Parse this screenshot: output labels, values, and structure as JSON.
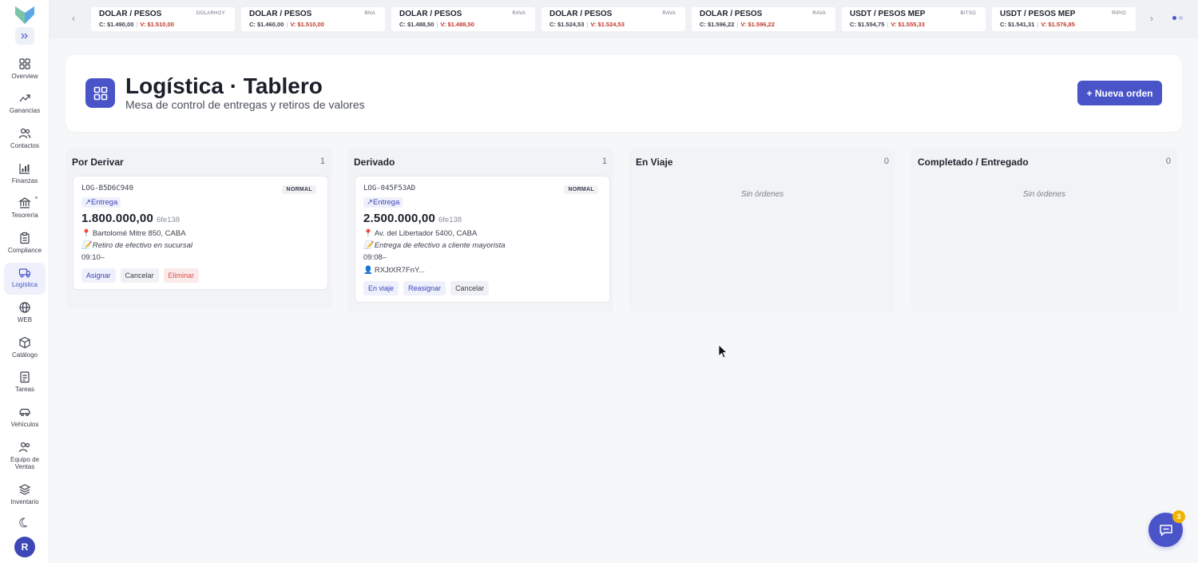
{
  "sidebar": {
    "items": [
      {
        "label": "Overview",
        "icon": "grid-icon"
      },
      {
        "label": "Ganancias",
        "icon": "trend-up-icon"
      },
      {
        "label": "Contactos",
        "icon": "users-icon"
      },
      {
        "label": "Finanzas",
        "icon": "bar-chart-icon"
      },
      {
        "label": "Tesorería",
        "icon": "bank-icon"
      },
      {
        "label": "Compliance",
        "icon": "clipboard-icon"
      },
      {
        "label": "Logística",
        "icon": "truck-icon"
      },
      {
        "label": "WEB",
        "icon": "globe-icon"
      },
      {
        "label": "Catálogo",
        "icon": "box-icon"
      },
      {
        "label": "Tareas",
        "icon": "checklist-icon"
      },
      {
        "label": "Vehículos",
        "icon": "car-icon"
      },
      {
        "label": "Equipo de Ventas",
        "icon": "team-icon"
      },
      {
        "label": "Inventario",
        "icon": "layers-icon"
      }
    ],
    "active": "Logística",
    "avatar": "R"
  },
  "ticker": {
    "items": [
      {
        "pair": "DOLAR / PESOS",
        "source": "DOLARHOY",
        "buy": "C: $1.490,00",
        "sell": "V: $1.510,00"
      },
      {
        "pair": "DOLAR / PESOS",
        "source": "BNA",
        "buy": "C: $1.460,00",
        "sell": "V: $1.510,00"
      },
      {
        "pair": "DOLAR / PESOS",
        "source": "RAVA",
        "buy": "C: $1.488,50",
        "sell": "V: $1.488,50"
      },
      {
        "pair": "DOLAR / PESOS",
        "source": "RAVA",
        "buy": "C: $1.524,53",
        "sell": "V: $1.524,53"
      },
      {
        "pair": "DOLAR / PESOS",
        "source": "RAVA",
        "buy": "C: $1.596,22",
        "sell": "V: $1.596,22"
      },
      {
        "pair": "USDT / PESOS MEP",
        "source": "BITSO",
        "buy": "C: $1.554,75",
        "sell": "V: $1.555,33"
      },
      {
        "pair": "USDT / PESOS MEP",
        "source": "RIPIO",
        "buy": "C: $1.541,31",
        "sell": "V: $1.576,85"
      }
    ]
  },
  "header": {
    "title": "Logística · Tablero",
    "subtitle": "Mesa de control de entregas y retiros de valores",
    "new_order": "+ Nueva orden"
  },
  "columns": [
    {
      "title": "Por Derivar",
      "count": "1"
    },
    {
      "title": "Derivado",
      "count": "1"
    },
    {
      "title": "En Viaje",
      "count": "0",
      "empty": "Sin órdenes"
    },
    {
      "title": "Completado / Entregado",
      "count": "0",
      "empty": "Sin órdenes"
    }
  ],
  "orders": [
    {
      "id": "LOG-B5D6C940",
      "priority": "NORMAL",
      "type": "↗Entrega",
      "amount": "1.800.000,00",
      "hash": "6fe138",
      "address": "Bartolomé Mitre 850, CABA",
      "note": "Retiro de efectivo en sucursal",
      "time": "09:10–",
      "actions": [
        "Asignar",
        "Cancelar",
        "Eliminar"
      ]
    },
    {
      "id": "LOG-045F53AD",
      "priority": "NORMAL",
      "type": "↗Entrega",
      "amount": "2.500.000,00",
      "hash": "6fe138",
      "address": "Av. del Libertador 5400, CABA",
      "note": "Entrega de efectivo a cliente mayorista",
      "time": "09:08–",
      "driver": "RXJtXR7FnY...",
      "actions": [
        "En viaje",
        "Reasignar",
        "Cancelar"
      ]
    }
  ],
  "chat": {
    "badge": "3"
  },
  "colors": {
    "accent": "#4a54c9",
    "danger": "#d9534f",
    "badge": "#f0b400"
  }
}
